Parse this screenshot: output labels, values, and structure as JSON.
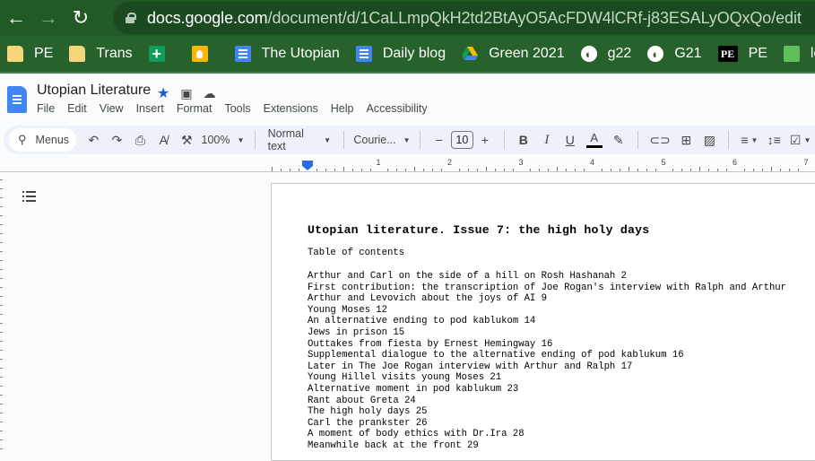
{
  "browser": {
    "url_host": "docs.google.com",
    "url_path": "/document/d/1CaLLmpQkH2td2BtAyO5AcFDW4lCRf-j83ESALyOQxQo/edit",
    "back_icon": "←",
    "forward_icon": "→",
    "reload_icon": "↻"
  },
  "bookmarks": [
    {
      "label": "PE",
      "icon": "folder-icon"
    },
    {
      "label": "Trans",
      "icon": "folder-icon"
    },
    {
      "label": "",
      "icon": "sheets-icon"
    },
    {
      "label": "",
      "icon": "keep-icon"
    },
    {
      "label": "The Utopian",
      "icon": "docs-icon"
    },
    {
      "label": "Daily blog",
      "icon": "docs-icon"
    },
    {
      "label": "Green 2021",
      "icon": "drive-icon"
    },
    {
      "label": "g22",
      "icon": "globe-icon"
    },
    {
      "label": "G21",
      "icon": "globe-icon"
    },
    {
      "label": "PE",
      "icon": "pe-icon",
      "icon_text": "PE"
    },
    {
      "label": "local",
      "icon": "local-icon"
    }
  ],
  "docs": {
    "title": "Utopian Literature",
    "menu": [
      "File",
      "Edit",
      "View",
      "Insert",
      "Format",
      "Tools",
      "Extensions",
      "Help",
      "Accessibility"
    ]
  },
  "toolbar": {
    "menus_label": "Menus",
    "zoom": "100%",
    "style": "Normal text",
    "font": "Courie...",
    "font_size": "10",
    "bold": "B",
    "italic": "I",
    "underline": "U",
    "text_color": "A"
  },
  "ruler": {
    "numbers": [
      "1",
      "2",
      "3",
      "4",
      "5",
      "6",
      "7"
    ]
  },
  "document": {
    "heading": "Utopian literature. Issue 7: the high holy days",
    "toc_label": "Table of contents",
    "toc_entries": [
      "Arthur and Carl on the side of a hill on Rosh Hashanah 2",
      "First contribution: the transcription of Joe Rogan's interview with Ralph and Arthur",
      "Arthur and Levovich about the joys of AI 9",
      "Young Moses 12",
      "An alternative ending to pod kablukom 14",
      "Jews in prison 15",
      "Outtakes from fiesta by Ernest Hemingway 16",
      "Supplemental dialogue to the alternative ending of pod kablukum 16",
      "Later in The Joe Rogan interview with Arthur and Ralph 17",
      "Young Hillel visits young Moses 21",
      "Alternative moment in pod kablukum 23",
      "Rant about Greta 24",
      "The high holy days 25",
      "Carl the prankster 26",
      "A moment of body ethics with Dr.Ira 28",
      "Meanwhile back at the front 29"
    ]
  },
  "colors": {
    "browser_green": "#225a26",
    "docs_blue": "#4285f4",
    "star_blue": "#1a5fd1",
    "toolbar_bg": "#edf2fa"
  }
}
